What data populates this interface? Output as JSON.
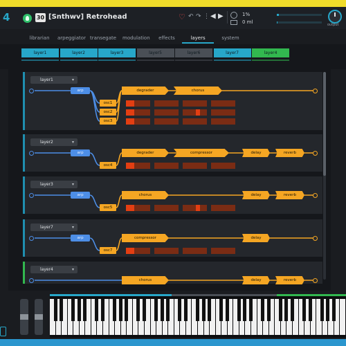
{
  "app": {
    "logo_digit": "4",
    "bank": "30",
    "preset_name": "[Snthwv] Retrohead",
    "cpu": "1%",
    "ram": "0 ml",
    "output_label": "output",
    "cpu_level": 0.05,
    "ram_level": 0.02,
    "volume": 0.85
  },
  "tabs": [
    {
      "label": "librarian"
    },
    {
      "label": "arpeggiator"
    },
    {
      "label": "transegate"
    },
    {
      "label": "modulation"
    },
    {
      "label": "effects"
    },
    {
      "label": "layers"
    },
    {
      "label": "system"
    }
  ],
  "active_tab": "layers",
  "layer_tabs": [
    {
      "label": "layer1",
      "color": "#27a7c9"
    },
    {
      "label": "layer2",
      "color": "#27a7c9"
    },
    {
      "label": "layer3",
      "color": "#27a7c9"
    },
    {
      "label": "layer5",
      "color": "#4a4f56"
    },
    {
      "label": "layer6",
      "color": "#4a4f56"
    },
    {
      "label": "layer7",
      "color": "#27a7c9"
    },
    {
      "label": "layer4",
      "color": "#32b84f"
    }
  ],
  "panels": [
    {
      "layer": "layer1",
      "arp": "arp",
      "oscs": [
        "osc1",
        "osc2",
        "osc3"
      ],
      "fx": [
        "degrader",
        "chorus"
      ]
    },
    {
      "layer": "layer2",
      "arp": "arp",
      "oscs": [
        "osc4"
      ],
      "fx": [
        "degrader",
        "compressor",
        "delay",
        "reverb"
      ]
    },
    {
      "layer": "layer3",
      "arp": "arp",
      "oscs": [
        "osc5"
      ],
      "fx": [
        "chorus",
        "delay",
        "reverb"
      ]
    },
    {
      "layer": "layer7",
      "arp": "arp",
      "oscs": [
        "osc7"
      ],
      "fx": [
        "compressor",
        "delay"
      ]
    },
    {
      "layer": "layer4",
      "arp": "",
      "oscs": [],
      "fx": [
        "chorus",
        "delay",
        "reverb"
      ]
    }
  ],
  "icons": {
    "favorite": "heart-icon",
    "undo": "undo-icon",
    "redo": "redo-icon",
    "prev": "prev-arrow-icon",
    "next": "next-arrow-icon",
    "cpu": "cpu-icon",
    "ram": "ram-icon",
    "brand": "brand-icon"
  },
  "colors": {
    "accent": "#27a7c9",
    "fx": "#f5a623",
    "arp": "#4d8ee6",
    "green": "#32b84f",
    "yellow": "#f0dc2a"
  }
}
